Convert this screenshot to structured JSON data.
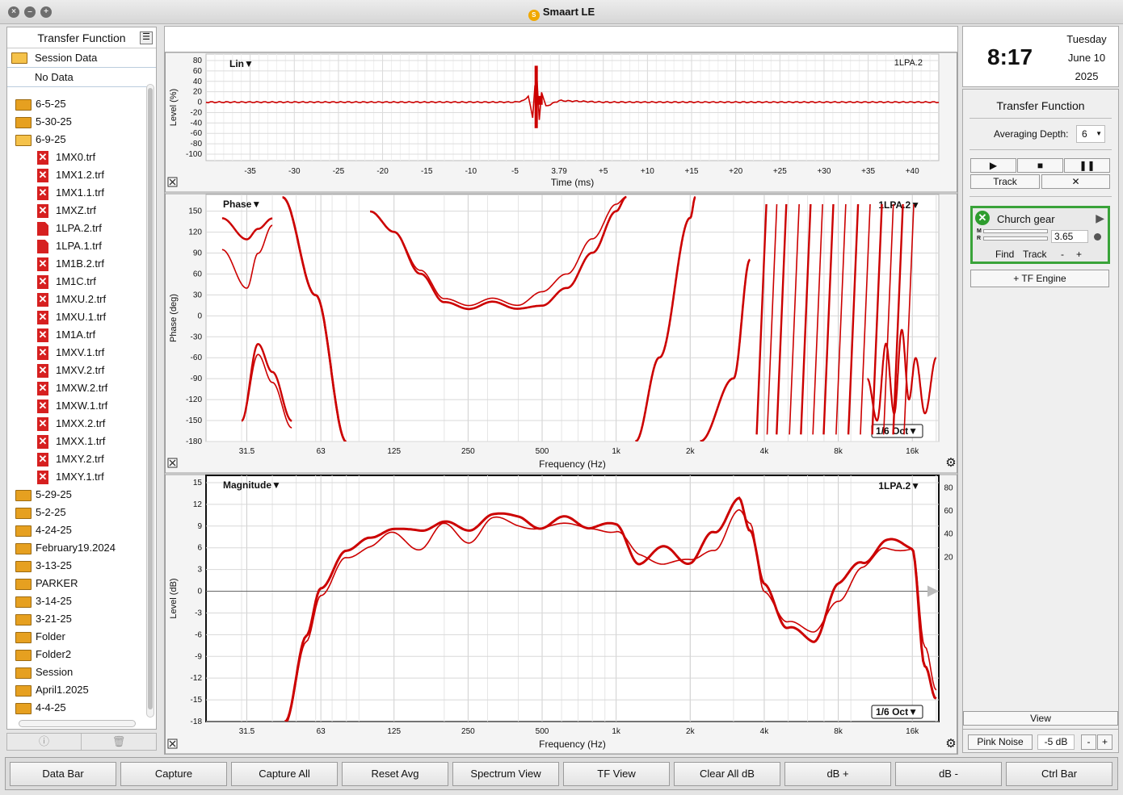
{
  "app_title": "Smaart LE",
  "sidebar": {
    "title": "Transfer Function",
    "session_label": "Session Data",
    "no_data": "No Data",
    "items": [
      {
        "type": "folder",
        "label": "6-5-25",
        "level": 0
      },
      {
        "type": "folder",
        "label": "5-30-25",
        "level": 0
      },
      {
        "type": "folder-open",
        "label": "6-9-25",
        "level": 0
      },
      {
        "type": "file-x",
        "label": "1MX0.trf",
        "level": 1
      },
      {
        "type": "file-x",
        "label": "1MX1.2.trf",
        "level": 1
      },
      {
        "type": "file-x",
        "label": "1MX1.1.trf",
        "level": 1
      },
      {
        "type": "file-x",
        "label": "1MXZ.trf",
        "level": 1
      },
      {
        "type": "file",
        "label": "1LPA.2.trf",
        "level": 1
      },
      {
        "type": "file",
        "label": "1LPA.1.trf",
        "level": 1
      },
      {
        "type": "file-x",
        "label": "1M1B.2.trf",
        "level": 1
      },
      {
        "type": "file-x",
        "label": "1M1C.trf",
        "level": 1
      },
      {
        "type": "file-x",
        "label": "1MXU.2.trf",
        "level": 1
      },
      {
        "type": "file-x",
        "label": "1MXU.1.trf",
        "level": 1
      },
      {
        "type": "file-x",
        "label": "1M1A.trf",
        "level": 1
      },
      {
        "type": "file-x",
        "label": "1MXV.1.trf",
        "level": 1
      },
      {
        "type": "file-x",
        "label": "1MXV.2.trf",
        "level": 1
      },
      {
        "type": "file-x",
        "label": "1MXW.2.trf",
        "level": 1
      },
      {
        "type": "file-x",
        "label": "1MXW.1.trf",
        "level": 1
      },
      {
        "type": "file-x",
        "label": "1MXX.2.trf",
        "level": 1
      },
      {
        "type": "file-x",
        "label": "1MXX.1.trf",
        "level": 1
      },
      {
        "type": "file-x",
        "label": "1MXY.2.trf",
        "level": 1
      },
      {
        "type": "file-x",
        "label": "1MXY.1.trf",
        "level": 1
      },
      {
        "type": "folder",
        "label": "5-29-25",
        "level": 0
      },
      {
        "type": "folder",
        "label": "5-2-25",
        "level": 0
      },
      {
        "type": "folder",
        "label": "4-24-25",
        "level": 0
      },
      {
        "type": "folder",
        "label": "February19.2024",
        "level": 0
      },
      {
        "type": "folder",
        "label": "3-13-25",
        "level": 0
      },
      {
        "type": "folder",
        "label": "PARKER",
        "level": 0
      },
      {
        "type": "folder",
        "label": "3-14-25",
        "level": 0
      },
      {
        "type": "folder",
        "label": "3-21-25",
        "level": 0
      },
      {
        "type": "folder",
        "label": "Folder",
        "level": 0
      },
      {
        "type": "folder",
        "label": "Folder2",
        "level": 0
      },
      {
        "type": "folder",
        "label": "Session",
        "level": 0
      },
      {
        "type": "folder",
        "label": "April1.2025",
        "level": 0
      },
      {
        "type": "folder",
        "label": "4-4-25",
        "level": 0
      }
    ]
  },
  "plots": {
    "ir": {
      "mode": "Lin▼",
      "trace": "1LPA.2",
      "ylabel": "Level (%)",
      "xlabel": "Time (ms)",
      "yticks": [
        "80",
        "60",
        "40",
        "20",
        "0",
        "-20",
        "-40",
        "-60",
        "-80",
        "-100"
      ],
      "xticks": [
        "-35",
        "-30",
        "-25",
        "-20",
        "-15",
        "-10",
        "-5",
        "3.79",
        "+5",
        "+10",
        "+15",
        "+20",
        "+25",
        "+30",
        "+35",
        "+40"
      ]
    },
    "phase": {
      "mode": "Phase▼",
      "trace": "1LPA.2▼",
      "ylabel": "Phase (deg)",
      "xlabel": "Frequency (Hz)",
      "smoothing": "1/6 Oct▼",
      "yticks": [
        "150",
        "120",
        "90",
        "60",
        "30",
        "0",
        "-30",
        "-60",
        "-90",
        "-120",
        "-150",
        "-180"
      ],
      "xticks": [
        "31.5",
        "63",
        "125",
        "250",
        "500",
        "1k",
        "2k",
        "4k",
        "8k",
        "16k"
      ]
    },
    "mag": {
      "mode": "Magnitude▼",
      "trace": "1LPA.2▼",
      "ylabel": "Level (dB)",
      "xlabel": "Frequency (Hz)",
      "smoothing": "1/6 Oct▼",
      "yticks": [
        "15",
        "12",
        "9",
        "6",
        "3",
        "0",
        "-3",
        "-6",
        "-9",
        "-12",
        "-15",
        "-18"
      ],
      "y2ticks": [
        "80",
        "60",
        "40",
        "20"
      ],
      "xticks": [
        "31.5",
        "63",
        "125",
        "250",
        "500",
        "1k",
        "2k",
        "4k",
        "8k",
        "16k"
      ]
    }
  },
  "chart_data": [
    {
      "type": "line",
      "title": "Lin",
      "xlabel": "Time (ms)",
      "ylabel": "Level (%)",
      "xlim": [
        -40,
        43
      ],
      "ylim": [
        -100,
        80
      ],
      "series": [
        {
          "name": "1LPA.2",
          "x": [
            -40,
            -5,
            -4,
            -3.5,
            -3,
            -2.6,
            -2.2,
            -2,
            -1.5,
            0,
            5,
            43
          ],
          "y": [
            0,
            0,
            3,
            12,
            -30,
            70,
            -50,
            20,
            -8,
            3,
            0,
            0
          ]
        }
      ]
    },
    {
      "type": "line",
      "title": "Phase",
      "xlabel": "Frequency (Hz)",
      "ylabel": "Phase (deg)",
      "ylim": [
        -180,
        160
      ],
      "xscale": "log",
      "series": [
        {
          "name": "1LPA.2",
          "x": [
            25,
            40,
            63,
            100,
            125,
            160,
            200,
            250,
            315,
            400,
            500,
            630,
            800,
            1000,
            1100
          ],
          "y": [
            140,
            115,
            -120,
            150,
            120,
            60,
            20,
            10,
            20,
            10,
            15,
            40,
            90,
            150,
            170
          ]
        },
        {
          "name": "1LPA.1",
          "x": [
            25,
            40,
            63,
            100,
            125,
            160,
            200,
            250,
            315,
            400,
            500,
            630,
            800,
            1000,
            1100
          ],
          "y": [
            95,
            125,
            -110,
            150,
            120,
            65,
            25,
            15,
            25,
            15,
            35,
            60,
            110,
            160,
            170
          ]
        }
      ]
    },
    {
      "type": "line",
      "title": "Magnitude",
      "xlabel": "Frequency (Hz)",
      "ylabel": "Level (dB)",
      "ylim": [
        -18,
        16
      ],
      "xscale": "log",
      "series": [
        {
          "name": "1LPA.2",
          "x": [
            45,
            55,
            63,
            80,
            100,
            125,
            160,
            200,
            250,
            315,
            400,
            500,
            630,
            800,
            1000,
            1250,
            1600,
            2000,
            2500,
            3150,
            3500,
            4000,
            5000,
            6300,
            8000,
            10000,
            12500,
            16000,
            18000,
            20000
          ],
          "y": [
            -18,
            -6,
            0,
            6,
            7,
            9,
            8,
            10,
            8,
            11,
            10,
            9,
            10,
            9,
            9,
            4,
            6,
            4,
            8,
            13,
            8,
            1,
            -5,
            -7,
            1,
            4,
            7,
            6,
            -10,
            -15
          ]
        },
        {
          "name": "1LPA.1",
          "x": [
            45,
            55,
            63,
            80,
            100,
            125,
            160,
            200,
            250,
            315,
            400,
            500,
            630,
            800,
            1000,
            1250,
            1600,
            2000,
            2500,
            3150,
            3500,
            4000,
            5000,
            6300,
            8000,
            10000,
            12500,
            16000,
            18000,
            20000
          ],
          "y": [
            -18,
            -7,
            -1,
            5,
            6,
            8,
            6,
            9,
            7,
            10,
            9,
            9,
            9,
            9,
            8,
            5,
            4,
            4,
            6,
            11,
            9,
            0,
            -4,
            -6,
            -1,
            3,
            6,
            6,
            -8,
            -14
          ]
        }
      ]
    }
  ],
  "right_panel": {
    "time": "8:17",
    "day": "Tuesday",
    "date": "June 10",
    "year": "2025",
    "section_title": "Transfer Function",
    "averaging_label": "Averaging Depth:",
    "averaging_value": "6",
    "track_label": "Track",
    "engine_name": "Church gear",
    "m_label": "M",
    "r_label": "R",
    "delay_value": "3.65",
    "find_label": "Find",
    "track2_label": "Track",
    "minus_label": "-",
    "plus_label": "+",
    "add_engine": "+ TF Engine",
    "view_label": "View",
    "pink_noise": "Pink Noise",
    "noise_level": "-5 dB",
    "noise_minus": "-",
    "noise_plus": "+"
  },
  "bottom_buttons": [
    "Data Bar",
    "Capture",
    "Capture All",
    "Reset Avg",
    "Spectrum View",
    "TF View",
    "Clear All dB",
    "dB +",
    "dB -",
    "Ctrl Bar"
  ],
  "colors": {
    "trace": "#cc0000",
    "engine_border": "#39a339"
  }
}
